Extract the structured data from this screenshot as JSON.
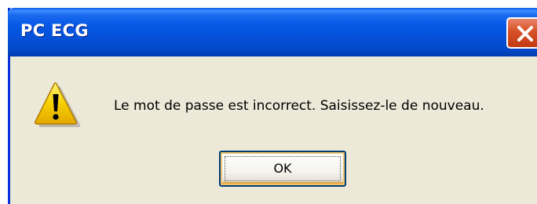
{
  "window": {
    "title": "PC ECG",
    "close_icon": "close-icon"
  },
  "dialog": {
    "icon": "warning-icon",
    "message": "Le mot de passe est incorrect. Saisissez-le de nouveau.",
    "ok_label": "OK"
  },
  "colors": {
    "titlebar": "#0551d9",
    "dialog_background": "#ece9d8",
    "close_button": "#d9542a",
    "warning_yellow": "#f6d000"
  }
}
